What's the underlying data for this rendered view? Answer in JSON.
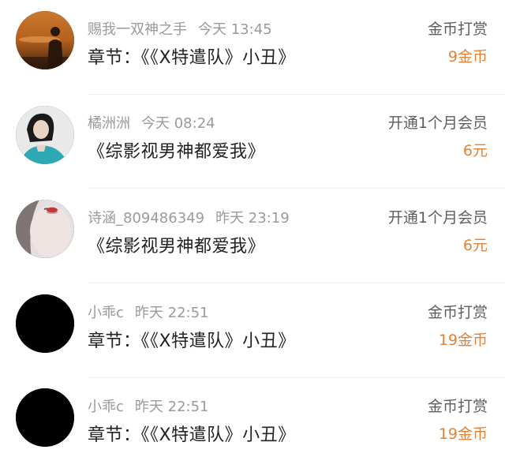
{
  "accent_color": "#e0833a",
  "items": [
    {
      "avatar_icon": "sunset-silhouette-avatar-icon",
      "username": "赐我一双神之手",
      "time": "今天 13:45",
      "title": "章节：《《X特遣队》小丑》",
      "type": "金币打赏",
      "amount": "9金币"
    },
    {
      "avatar_icon": "girl-portrait-avatar-icon",
      "username": "橘洲洲",
      "time": "今天 08:24",
      "title": "《综影视男神都爱我》",
      "type": "开通1个月会员",
      "amount": "6元"
    },
    {
      "avatar_icon": "face-portrait-avatar-icon",
      "username": "诗涵_809486349",
      "time": "昨天 23:19",
      "title": "《综影视男神都爱我》",
      "type": "开通1个月会员",
      "amount": "6元"
    },
    {
      "avatar_icon": "black-avatar-icon",
      "username": "小乖c",
      "time": "昨天 22:51",
      "title": "章节：《《X特遣队》小丑》",
      "type": "金币打赏",
      "amount": "19金币"
    },
    {
      "avatar_icon": "black-avatar-icon",
      "username": "小乖c",
      "time": "昨天 22:51",
      "title": "章节：《《X特遣队》小丑》",
      "type": "金币打赏",
      "amount": "19金币"
    }
  ]
}
